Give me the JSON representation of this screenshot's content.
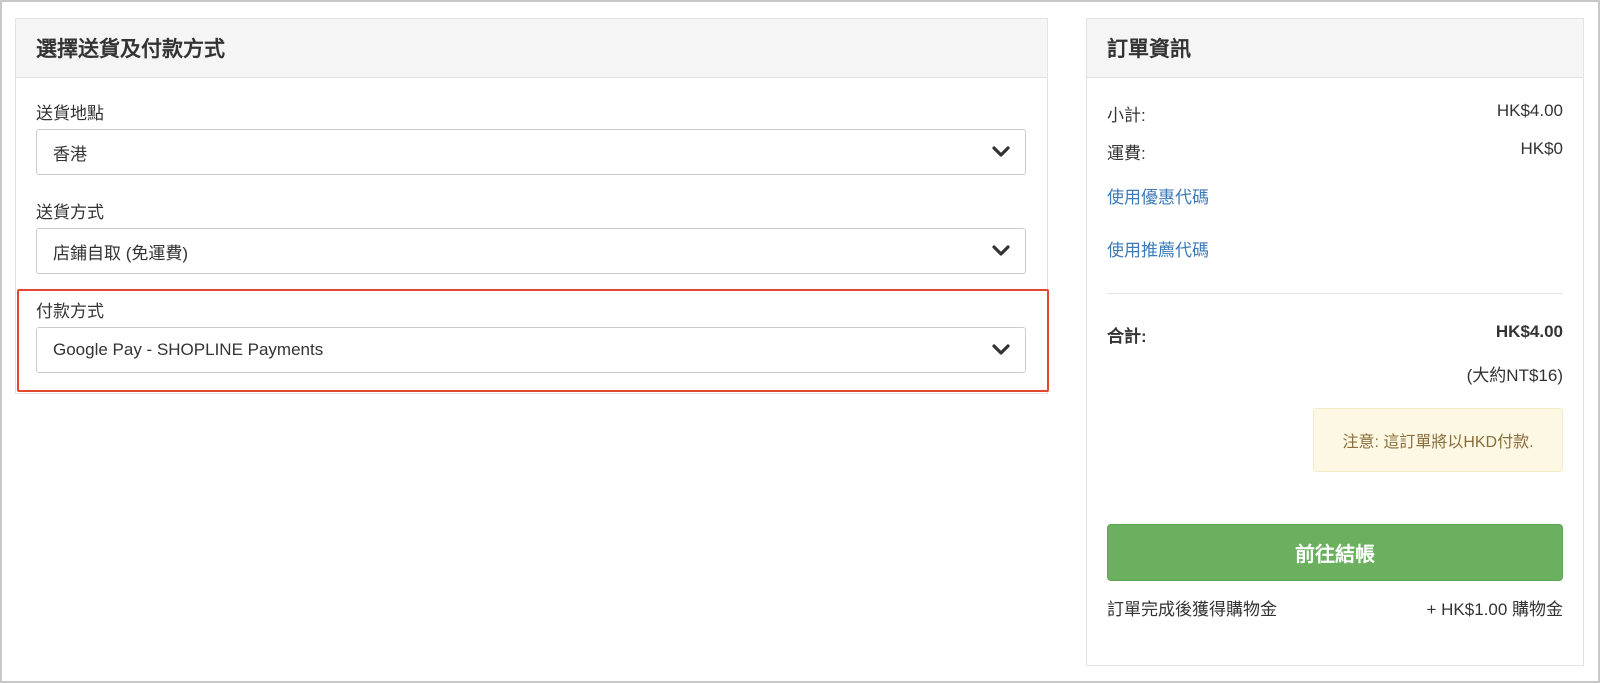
{
  "left_panel": {
    "title": "選擇送貨及付款方式",
    "delivery_location": {
      "label": "送貨地點",
      "value": "香港"
    },
    "delivery_method": {
      "label": "送貨方式",
      "value": "店鋪自取 (免運費)"
    },
    "payment_method": {
      "label": "付款方式",
      "value": "Google Pay - SHOPLINE Payments"
    }
  },
  "right_panel": {
    "title": "訂單資訊",
    "subtotal_label": "小計:",
    "subtotal_value": "HK$4.00",
    "shipping_label": "運費:",
    "shipping_value": "HK$0",
    "coupon_link": "使用優惠代碼",
    "referral_link": "使用推薦代碼",
    "total_label": "合計:",
    "total_value": "HK$4.00",
    "total_approx": "(大約NT$16)",
    "notice": "注意: 這訂單將以HKD付款.",
    "checkout_button": "前往結帳",
    "reward_label": "訂單完成後獲得購物金",
    "reward_value": "+ HK$1.00 購物金"
  },
  "colors": {
    "highlight_border": "#e2472f",
    "checkout_green": "#6ab05f",
    "link_blue": "#3d7ab8",
    "notice_bg": "#fcf8e3",
    "notice_text": "#8a6d3b"
  }
}
